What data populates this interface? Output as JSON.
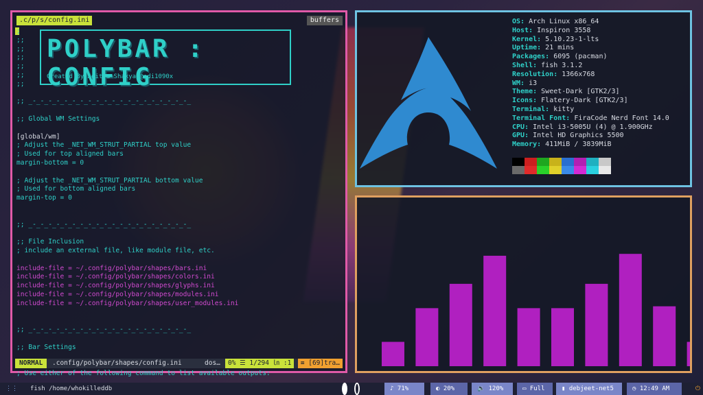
{
  "editor": {
    "tab_active": ".c/p/s/config.ini",
    "tab_buffers": "buffers",
    "banner_title": "POLYBAR : CONFIG",
    "banner_subtitle": "Created By Aditya Shakya @adi1090x",
    "lines": [
      {
        "text": ";",
        "cls": "c-comment"
      },
      {
        "text": ";;",
        "cls": "c-comment"
      },
      {
        "text": ";;",
        "cls": "c-comment"
      },
      {
        "text": ";;",
        "cls": "c-comment"
      },
      {
        "text": ";;",
        "cls": "c-comment"
      },
      {
        "text": ";;",
        "cls": "c-comment"
      },
      {
        "text": ";;",
        "cls": "c-comment"
      },
      {
        "text": "",
        "cls": "c-comment"
      },
      {
        "text": ";; _-_-_-_-_-_-_-_-_-_-_-_-_-_-_-_-_-_-_-_-_",
        "cls": "c-comment"
      },
      {
        "text": "",
        "cls": "c-comment"
      },
      {
        "text": ";; Global WM Settings",
        "cls": "c-comment"
      },
      {
        "text": "",
        "cls": "c-comment"
      },
      {
        "text": "[global/wm]",
        "cls": "c-section"
      },
      {
        "text": "; Adjust the _NET_WM_STRUT_PARTIAL top value",
        "cls": "c-comment"
      },
      {
        "text": "; Used for top aligned bars",
        "cls": "c-comment"
      },
      {
        "text": "margin-bottom = 0",
        "cls": "c-key"
      },
      {
        "text": "",
        "cls": "c-comment"
      },
      {
        "text": "; Adjust the _NET_WM_STRUT_PARTIAL bottom value",
        "cls": "c-comment"
      },
      {
        "text": "; Used for bottom aligned bars",
        "cls": "c-comment"
      },
      {
        "text": "margin-top = 0",
        "cls": "c-key"
      },
      {
        "text": "",
        "cls": "c-comment"
      },
      {
        "text": "",
        "cls": "c-comment"
      },
      {
        "text": ";; _-_-_-_-_-_-_-_-_-_-_-_-_-_-_-_-_-_-_-_-_",
        "cls": "c-comment"
      },
      {
        "text": "",
        "cls": "c-comment"
      },
      {
        "text": ";; File Inclusion",
        "cls": "c-comment"
      },
      {
        "text": "; include an external file, like module file, etc.",
        "cls": "c-comment"
      },
      {
        "text": "",
        "cls": "c-comment"
      },
      {
        "text": "include-file = ~/.config/polybar/shapes/bars.ini",
        "cls": "c-val"
      },
      {
        "text": "include-file = ~/.config/polybar/shapes/colors.ini",
        "cls": "c-val"
      },
      {
        "text": "include-file = ~/.config/polybar/shapes/glyphs.ini",
        "cls": "c-val"
      },
      {
        "text": "include-file = ~/.config/polybar/shapes/modules.ini",
        "cls": "c-val"
      },
      {
        "text": "include-file = ~/.config/polybar/shapes/user_modules.ini",
        "cls": "c-val"
      },
      {
        "text": "",
        "cls": "c-comment"
      },
      {
        "text": "",
        "cls": "c-comment"
      },
      {
        "text": ";; _-_-_-_-_-_-_-_-_-_-_-_-_-_-_-_-_-_-_-_-_",
        "cls": "c-comment"
      },
      {
        "text": "",
        "cls": "c-comment"
      },
      {
        "text": ";; Bar Settings",
        "cls": "c-comment"
      },
      {
        "text": "",
        "cls": "c-comment"
      },
      {
        "text": "[bar/main]",
        "cls": "c-section"
      },
      {
        "text": "; Use either of the following command to list available outputs:",
        "cls": "c-comment"
      }
    ],
    "status": {
      "mode": "NORMAL",
      "file": ".config/polybar/shapes/config.ini",
      "filetype": "dos…",
      "position": "0% ☰ 1/294 ㏑ :1",
      "trailing": "≡ [69]tra…"
    }
  },
  "fetch": {
    "rows": [
      {
        "key": "OS",
        "value": "Arch Linux x86_64"
      },
      {
        "key": "Host",
        "value": "Inspiron 3558"
      },
      {
        "key": "Kernel",
        "value": "5.10.23-1-lts"
      },
      {
        "key": "Uptime",
        "value": "21 mins"
      },
      {
        "key": "Packages",
        "value": "6095 (pacman)"
      },
      {
        "key": "Shell",
        "value": "fish 3.1.2"
      },
      {
        "key": "Resolution",
        "value": "1366x768"
      },
      {
        "key": "WM",
        "value": "i3"
      },
      {
        "key": "Theme",
        "value": "Sweet-Dark [GTK2/3]"
      },
      {
        "key": "Icons",
        "value": "Flatery-Dark [GTK2/3]"
      },
      {
        "key": "Terminal",
        "value": "kitty"
      },
      {
        "key": "Terminal Font",
        "value": "FiraCode Nerd Font 14.0"
      },
      {
        "key": "CPU",
        "value": "Intel i3-5005U (4) @ 1.900GHz"
      },
      {
        "key": "GPU",
        "value": "Intel HD Graphics 5500"
      },
      {
        "key": "Memory",
        "value": "411MiB / 3839MiB"
      }
    ],
    "palette_top": [
      "#000000",
      "#cc1f1f",
      "#1fa61f",
      "#c8b21a",
      "#2a6fd0",
      "#b31fb3",
      "#1fb0c0",
      "#c8c8c8"
    ],
    "palette_bottom": [
      "#6a6a6a",
      "#e02a2a",
      "#2ad02a",
      "#e0d02a",
      "#3a8ae8",
      "#d42ad4",
      "#2ad0e0",
      "#e8e8e8"
    ],
    "logo_color": "#2f8ad0"
  },
  "cava": {
    "color": "#b020c0",
    "levels": [
      0.13,
      0.31,
      0.44,
      0.59,
      0.31,
      0.31,
      0.44,
      0.6,
      0.32,
      0.13
    ]
  },
  "bar": {
    "workspace_icon": "⋮⋮",
    "terminal_title": "fish /home/whokilleddb",
    "modules": [
      {
        "name": "volume-module",
        "icon": "♪",
        "label": "71%"
      },
      {
        "name": "brightness-module",
        "icon": "◐",
        "label": "20%"
      },
      {
        "name": "battery-module",
        "icon": "🔉",
        "label": "120%"
      },
      {
        "name": "power-module",
        "icon": "▭",
        "label": "Full"
      },
      {
        "name": "network-module",
        "icon": "▮",
        "label": "debjeet-net5"
      },
      {
        "name": "clock-module",
        "icon": "◷",
        "label": "12:49 AM"
      }
    ],
    "gear_icon": "⏻"
  }
}
